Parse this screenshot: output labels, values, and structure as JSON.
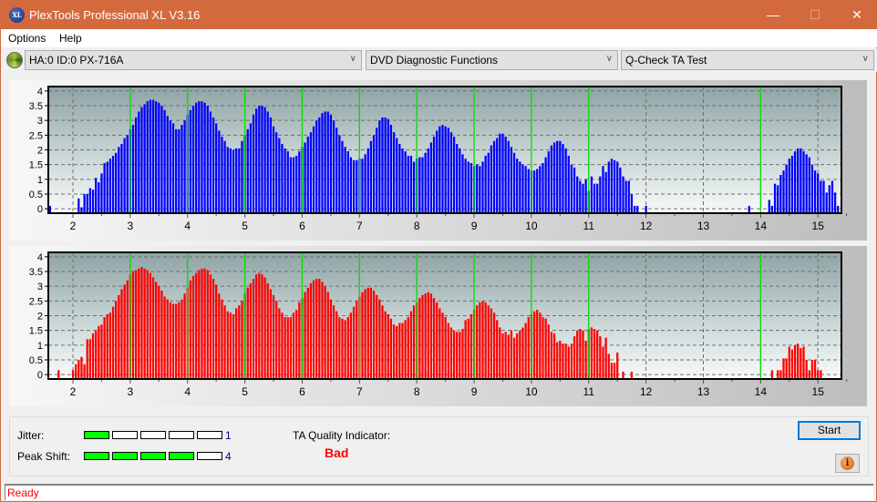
{
  "window": {
    "title": "PlexTools Professional XL V3.16",
    "logo_text": "XL",
    "minimize": "—",
    "maximize": "☐",
    "close": "✕"
  },
  "menu": {
    "items": [
      "Options",
      "Help"
    ]
  },
  "toolbar": {
    "drive": "HA:0 ID:0  PX-716A",
    "function": "DVD Diagnostic Functions",
    "test": "Q-Check TA Test",
    "chevron": "∨"
  },
  "colors": {
    "land_bars": "#0000ff",
    "pit_bars": "#ff0000",
    "reference_lines": "#00e000",
    "meter_on": "#00ff00",
    "quality_bad": "#ff0000"
  },
  "chart_data": [
    {
      "type": "bar",
      "name": "upper-chart",
      "series_color": "blue",
      "title": "",
      "xlabel": "",
      "ylabel": "",
      "xlim": [
        1.57,
        15.41
      ],
      "ylim": [
        -0.15,
        4.15
      ],
      "x_ticks": [
        2,
        3,
        4,
        5,
        6,
        7,
        8,
        9,
        10,
        11,
        12,
        13,
        14,
        15
      ],
      "y_ticks": [
        0,
        0.5,
        1,
        1.5,
        2,
        2.5,
        3,
        3.5,
        4
      ],
      "y_tick_labels": [
        "0",
        "0.5",
        "1",
        "1.5",
        "2",
        "2.5",
        "3",
        "3.5",
        "4"
      ],
      "reference_lines": [
        3,
        4,
        5,
        6,
        7,
        8,
        9,
        10,
        11,
        14
      ],
      "grid": true,
      "x_start": 1.6,
      "x_step": 0.05,
      "values": [
        0.1,
        0,
        0,
        0,
        0,
        0,
        0,
        0,
        0,
        0,
        0.35,
        0.05,
        0.5,
        0.5,
        0.7,
        0.65,
        1.05,
        0.9,
        1.2,
        1.55,
        1.6,
        1.7,
        1.8,
        1.9,
        2.1,
        2.2,
        2.4,
        2.5,
        2.7,
        2.85,
        3.1,
        3.3,
        3.45,
        3.55,
        3.65,
        3.7,
        3.7,
        3.65,
        3.6,
        3.5,
        3.35,
        3.15,
        3,
        2.9,
        2.7,
        2.7,
        2.85,
        3,
        3.2,
        3.35,
        3.5,
        3.6,
        3.65,
        3.65,
        3.6,
        3.5,
        3.3,
        3.1,
        2.9,
        2.65,
        2.45,
        2.3,
        2.1,
        2.05,
        2,
        2.05,
        2.05,
        2.3,
        2.5,
        2.7,
        2.9,
        3.2,
        3.4,
        3.5,
        3.5,
        3.45,
        3.3,
        3.1,
        2.8,
        2.6,
        2.4,
        2.2,
        2.05,
        1.95,
        1.75,
        1.75,
        1.8,
        1.95,
        2.1,
        2.25,
        2.45,
        2.6,
        2.8,
        3,
        3.1,
        3.25,
        3.3,
        3.3,
        3.2,
        3,
        2.75,
        2.5,
        2.3,
        2.1,
        1.95,
        1.75,
        1.65,
        1.65,
        1.7,
        1.7,
        1.85,
        2.05,
        2.3,
        2.5,
        2.75,
        3,
        3.1,
        3.1,
        3.05,
        2.85,
        2.6,
        2.4,
        2.2,
        2.05,
        1.95,
        1.8,
        1.8,
        1.6,
        1.7,
        1.75,
        1.75,
        1.9,
        2.05,
        2.25,
        2.45,
        2.65,
        2.8,
        2.85,
        2.8,
        2.75,
        2.6,
        2.45,
        2.2,
        2.05,
        1.85,
        1.7,
        1.6,
        1.55,
        1.45,
        1.5,
        1.45,
        1.6,
        1.8,
        1.9,
        2.15,
        2.3,
        2.4,
        2.55,
        2.55,
        2.45,
        2.3,
        2.1,
        1.9,
        1.7,
        1.6,
        1.5,
        1.45,
        1.35,
        1.3,
        1.3,
        1.35,
        1.45,
        1.55,
        1.75,
        1.95,
        2.15,
        2.25,
        2.3,
        2.3,
        2.2,
        2.05,
        1.8,
        1.5,
        1.4,
        1.1,
        0.95,
        0.85,
        1,
        0.6,
        1.1,
        0.85,
        0.85,
        1.1,
        1.45,
        1.25,
        1.6,
        1.7,
        1.65,
        1.6,
        1.4,
        1.1,
        0.95,
        0.95,
        0.5,
        0.1,
        0.1,
        0,
        0,
        0.1,
        0,
        0,
        0,
        0,
        0,
        0,
        0,
        0,
        0,
        0,
        0,
        0,
        0,
        0,
        0,
        0,
        0,
        0,
        0,
        0,
        0,
        0,
        0,
        0,
        0,
        0,
        0,
        0,
        0,
        0,
        0,
        0,
        0,
        0,
        0,
        0.1,
        0,
        0,
        0,
        0,
        0,
        0,
        0.3,
        0.1,
        0.85,
        0.8,
        1.15,
        1.3,
        1.5,
        1.7,
        1.8,
        1.95,
        2.05,
        2.05,
        1.95,
        1.85,
        1.75,
        1.5,
        1.3,
        1.2,
        0.95,
        0.95,
        0.55,
        0.8,
        0.95,
        0.55,
        0.1,
        0,
        0.1,
        0.5
      ]
    },
    {
      "type": "bar",
      "name": "lower-chart",
      "series_color": "red",
      "title": "",
      "xlabel": "",
      "ylabel": "",
      "xlim": [
        1.57,
        15.41
      ],
      "ylim": [
        -0.15,
        4.15
      ],
      "x_ticks": [
        2,
        3,
        4,
        5,
        6,
        7,
        8,
        9,
        10,
        11,
        12,
        13,
        14,
        15
      ],
      "y_ticks": [
        0,
        0.5,
        1,
        1.5,
        2,
        2.5,
        3,
        3.5,
        4
      ],
      "y_tick_labels": [
        "0",
        "0.5",
        "1",
        "1.5",
        "2",
        "2.5",
        "3",
        "3.5",
        "4"
      ],
      "reference_lines": [
        3,
        4,
        5,
        6,
        7,
        8,
        9,
        10,
        11,
        14
      ],
      "grid": true,
      "x_start": 1.6,
      "x_step": 0.05,
      "values": [
        0,
        0,
        0,
        0.15,
        0,
        0,
        0,
        0,
        0.15,
        0.35,
        0.5,
        0.6,
        0.35,
        1.2,
        1.2,
        1.4,
        1.5,
        1.65,
        1.7,
        1.95,
        2.05,
        2.1,
        2.3,
        2.5,
        2.7,
        2.9,
        3.05,
        3.2,
        3.4,
        3.5,
        3.55,
        3.6,
        3.65,
        3.6,
        3.55,
        3.45,
        3.3,
        3.15,
        3,
        2.85,
        2.65,
        2.55,
        2.45,
        2.4,
        2.4,
        2.45,
        2.55,
        2.75,
        2.95,
        3.2,
        3.35,
        3.45,
        3.55,
        3.6,
        3.6,
        3.55,
        3.4,
        3.25,
        3.05,
        2.75,
        2.55,
        2.35,
        2.15,
        2.1,
        2.05,
        2.25,
        2.35,
        2.5,
        2.75,
        2.95,
        3.1,
        3.25,
        3.4,
        3.45,
        3.4,
        3.3,
        3.1,
        2.9,
        2.7,
        2.5,
        2.25,
        2.1,
        1.95,
        1.95,
        1.95,
        2.1,
        2.2,
        2.45,
        2.6,
        2.8,
        2.95,
        3.1,
        3.2,
        3.25,
        3.25,
        3.15,
        3,
        2.8,
        2.55,
        2.35,
        2.15,
        1.95,
        1.9,
        1.85,
        1.95,
        2.1,
        2.3,
        2.5,
        2.65,
        2.8,
        2.9,
        2.95,
        2.95,
        2.85,
        2.7,
        2.55,
        2.35,
        2.15,
        2.05,
        1.9,
        1.7,
        1.65,
        1.75,
        1.75,
        1.85,
        1.95,
        2.15,
        2.35,
        2.45,
        2.6,
        2.7,
        2.75,
        2.8,
        2.75,
        2.6,
        2.45,
        2.25,
        2.1,
        1.95,
        1.75,
        1.6,
        1.5,
        1.45,
        1.45,
        1.55,
        1.85,
        1.9,
        2.05,
        2.2,
        2.35,
        2.45,
        2.5,
        2.45,
        2.35,
        2.25,
        2.1,
        1.85,
        1.6,
        1.4,
        1.45,
        1.35,
        1.5,
        1.25,
        1.4,
        1.5,
        1.6,
        1.75,
        1.95,
        2.05,
        2.15,
        2.2,
        2.1,
        1.95,
        1.9,
        1.7,
        1.45,
        1.4,
        1.1,
        1.15,
        1.05,
        1.05,
        0.95,
        1.05,
        1.3,
        1.5,
        1.55,
        1.5,
        1.15,
        1.55,
        1.6,
        1.55,
        1.5,
        1.3,
        0.95,
        1.25,
        0.7,
        0.4,
        0.4,
        0.75,
        0,
        0.1,
        0,
        0,
        0.1,
        0,
        0,
        0,
        0,
        0,
        0,
        0,
        0,
        0,
        0,
        0,
        0,
        0,
        0,
        0,
        0,
        0,
        0,
        0,
        0,
        0,
        0,
        0,
        0,
        0,
        0,
        0,
        0,
        0,
        0,
        0,
        0,
        0,
        0,
        0,
        0,
        0,
        0,
        0,
        0,
        0,
        0,
        0,
        0,
        0,
        0,
        0,
        0,
        0.15,
        0,
        0.15,
        0.15,
        0.55,
        0.55,
        0.95,
        0.85,
        1.0,
        1.05,
        0.9,
        0.95,
        0.5,
        0.15,
        0.5,
        0.5,
        0.15,
        0.15
      ]
    }
  ],
  "results": {
    "jitter_label": "Jitter:",
    "jitter_value": "1",
    "jitter_level": 1,
    "peak_shift_label": "Peak Shift:",
    "peak_shift_value": "4",
    "peak_shift_level": 4,
    "meter_segments": 5,
    "quality_label": "TA Quality Indicator:",
    "quality_value": "Bad"
  },
  "buttons": {
    "start": "Start",
    "info": "i"
  },
  "status": {
    "text": "Ready"
  }
}
